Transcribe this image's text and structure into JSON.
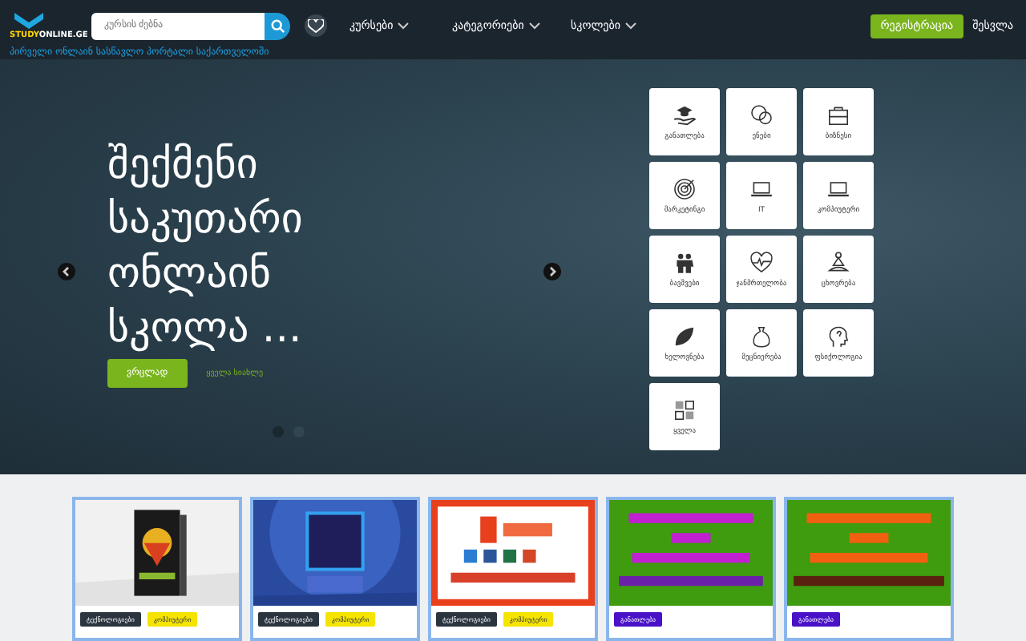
{
  "header": {
    "logo": {
      "brand": "STUDY",
      "domain": "ONLINE.GE"
    },
    "search": {
      "placeholder": "კურსის ძებნა"
    },
    "menu": [
      {
        "label": "კურსები"
      },
      {
        "label": "კატეგორიები"
      },
      {
        "label": "სკოლები"
      }
    ],
    "register_button": "რეგისტრაცია",
    "login_link": "შესვლა",
    "tagline": "პირველი ონლაინ სასწავლო პორტალი საქართველოში"
  },
  "hero": {
    "title": "შექმენი საკუთარი ონლაინ სკოლა ...",
    "more_button": "ვრცლად",
    "all_news_link": "ყველა სიახლე",
    "dots": [
      {
        "selected": true
      },
      {
        "selected": false
      }
    ]
  },
  "categories": [
    {
      "label": "განათლება"
    },
    {
      "label": "ენები"
    },
    {
      "label": "ბიზნესი"
    },
    {
      "label": "მარკეტინგი"
    },
    {
      "label": "IT"
    },
    {
      "label": "კომპიუტერი"
    },
    {
      "label": "ბავშვები"
    },
    {
      "label": "ჯანმრთელობა"
    },
    {
      "label": "ცხოვრება"
    },
    {
      "label": "ხელოვნება"
    },
    {
      "label": "მეცნიერება"
    },
    {
      "label": "ფსიქოლოგია"
    },
    {
      "label": "ყველა"
    }
  ],
  "courses": [
    {
      "tags": [
        {
          "label": "ტექნოლოგიები",
          "color": "#2b3540"
        },
        {
          "label": "კომპიუტერი",
          "color": "#f5e400"
        }
      ]
    },
    {
      "tags": [
        {
          "label": "ტექნოლოგიები",
          "color": "#2b3540"
        },
        {
          "label": "კომპიუტერი",
          "color": "#f5e400"
        }
      ]
    },
    {
      "tags": [
        {
          "label": "ტექნოლოგიები",
          "color": "#2b3540"
        },
        {
          "label": "კომპიუტერი",
          "color": "#f5e400"
        }
      ]
    },
    {
      "tags": [
        {
          "label": "განათლება",
          "color": "#4a12c8"
        }
      ]
    },
    {
      "tags": [
        {
          "label": "განათლება",
          "color": "#4a12c8"
        }
      ]
    }
  ]
}
